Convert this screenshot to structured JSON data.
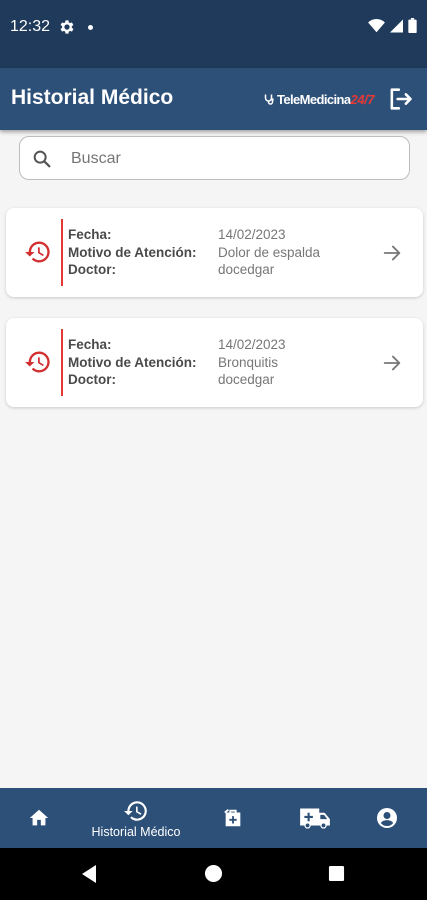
{
  "status_bar": {
    "time": "12:32"
  },
  "app_bar": {
    "title": "Historial Médico",
    "brand_main": "TeleMedicina",
    "brand_accent": "24/7"
  },
  "search": {
    "placeholder": "Buscar"
  },
  "records": [
    {
      "labels": [
        "Fecha:",
        "Motivo de Atención:",
        "Doctor:"
      ],
      "fecha": "14/02/2023",
      "motivo": "Dolor de espalda",
      "doctor": "docedgar"
    },
    {
      "labels": [
        "Fecha:",
        "Motivo de Atención:",
        "Doctor:"
      ],
      "fecha": "14/02/2023",
      "motivo": "Bronquitis",
      "doctor": "docedgar"
    }
  ],
  "bottom_nav": {
    "items": [
      {
        "icon": "home-icon",
        "label": ""
      },
      {
        "icon": "history-icon",
        "label": "Historial Médico",
        "active": true
      },
      {
        "icon": "medical-bag-icon",
        "label": ""
      },
      {
        "icon": "ambulance-icon",
        "label": ""
      },
      {
        "icon": "account-icon",
        "label": ""
      }
    ]
  },
  "colors": {
    "primary": "#2d5079",
    "status_bar": "#1f3a5a",
    "accent": "#e53935",
    "background": "#f5f5f5"
  }
}
